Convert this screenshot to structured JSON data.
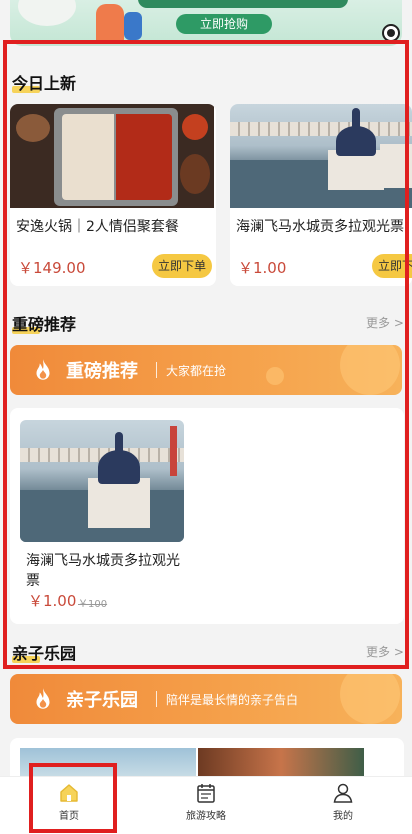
{
  "banner": {
    "cta_label": "立即抢购",
    "icon": "target-icon"
  },
  "sections": {
    "new_today": {
      "title": "今日上新"
    },
    "recommend": {
      "title": "重磅推荐",
      "more": "更多 >"
    },
    "family": {
      "title": "亲子乐园",
      "more": "更多 >"
    }
  },
  "new_today_cards": [
    {
      "name": "安逸火锅｜2人情侣聚套餐",
      "price": "￥149.00",
      "buy": "立即下单"
    },
    {
      "name": "海澜飞马水城贡多拉观光票",
      "price": "￥1.00",
      "buy": "立即下单"
    }
  ],
  "promo_recommend": {
    "title": "重磅推荐",
    "subtitle": "大家都在抢"
  },
  "featured": {
    "name_line1": "海澜飞马水城贡多拉观光",
    "name_line2": "票",
    "price": "￥1.00",
    "original_price": "￥100"
  },
  "promo_family": {
    "title": "亲子乐园",
    "subtitle": "陪伴是最长情的亲子告白"
  },
  "nav": [
    {
      "label": "首页",
      "icon": "home-icon"
    },
    {
      "label": "旅游攻略",
      "icon": "calendar-icon"
    },
    {
      "label": "我的",
      "icon": "user-icon"
    }
  ],
  "colors": {
    "accent_yellow": "#f5c842",
    "price_red": "#c94a3a",
    "promo_orange": "#f08a3a",
    "annotation_red": "#e01f1f"
  }
}
